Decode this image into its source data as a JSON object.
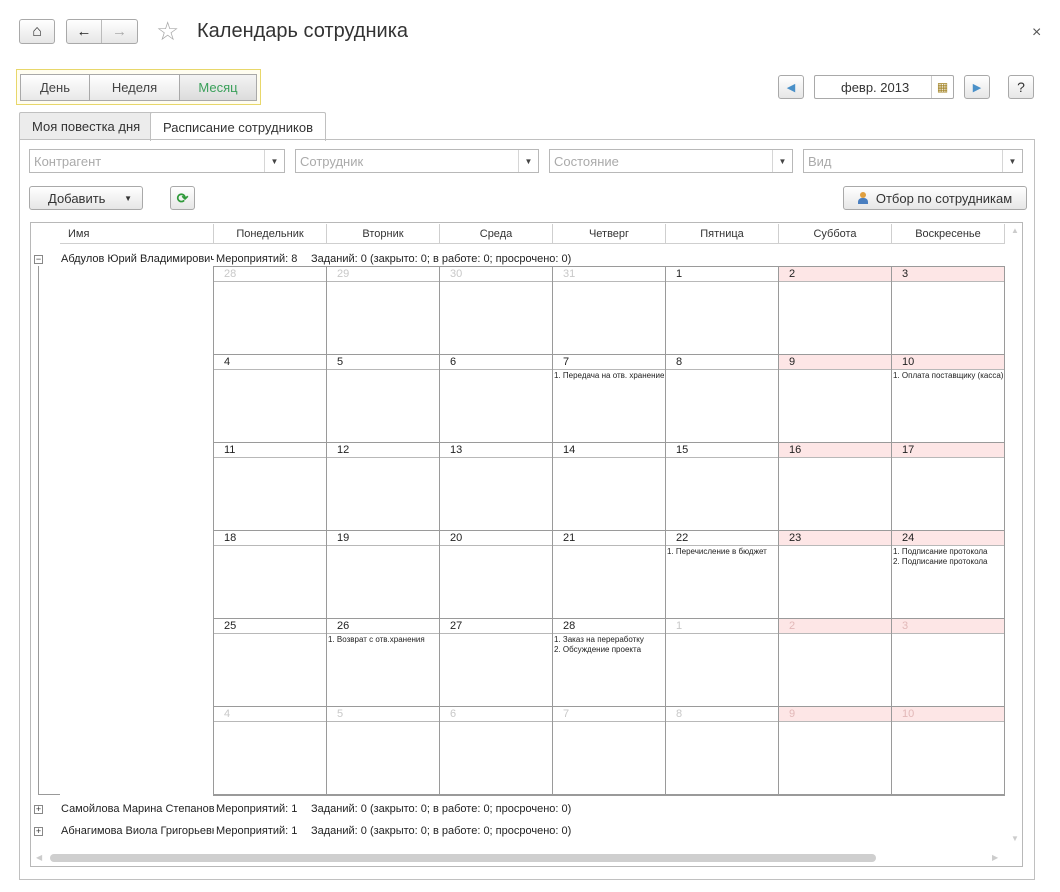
{
  "window": {
    "title": "Календарь сотрудника",
    "close_glyph": "×"
  },
  "nav": {
    "home_icon": "⌂",
    "back_icon": "←",
    "forward_icon": "→",
    "favorite_icon": "☆"
  },
  "period_buttons": [
    "День",
    "Неделя",
    "Месяц"
  ],
  "period_active": "Месяц",
  "period_nav": {
    "prev_icon": "◀",
    "current": "февр. 2013",
    "calendar_icon": "▦",
    "next_icon": "▶",
    "help": "?"
  },
  "tabs": [
    "Моя повестка дня",
    "Расписание сотрудников"
  ],
  "active_tab": "Расписание сотрудников",
  "filters": [
    {
      "placeholder": "Контрагент"
    },
    {
      "placeholder": "Сотрудник"
    },
    {
      "placeholder": "Состояние"
    },
    {
      "placeholder": "Вид"
    }
  ],
  "toolbar": {
    "add_label": "Добавить",
    "refresh_icon": "⟳",
    "select_employees_label": "Отбор по сотрудникам"
  },
  "grid": {
    "name_header": "Имя",
    "weekdays": [
      "Понедельник",
      "Вторник",
      "Среда",
      "Четверг",
      "Пятница",
      "Суббота",
      "Воскресенье"
    ]
  },
  "employees": [
    {
      "name": "Абдулов Юрий Владимирович",
      "expanded": true,
      "events": "Мероприятий: 8",
      "tasks": "Заданий: 0 (закрыто: 0; в работе: 0; просрочено: 0)"
    },
    {
      "name": "Самойлова Марина Степановна",
      "expanded": false,
      "events": "Мероприятий: 1",
      "tasks": "Заданий: 0 (закрыто: 0; в работе: 0; просрочено: 0)"
    },
    {
      "name": "Абнагимова Виола Григорьевна",
      "expanded": false,
      "events": "Мероприятий: 1",
      "tasks": "Заданий: 0 (закрыто: 0; в работе: 0; просрочено: 0)"
    }
  ],
  "calendar": {
    "weeks": [
      [
        {
          "d": "28",
          "other": true
        },
        {
          "d": "29",
          "other": true
        },
        {
          "d": "30",
          "other": true
        },
        {
          "d": "31",
          "other": true
        },
        {
          "d": "1"
        },
        {
          "d": "2"
        },
        {
          "d": "3"
        }
      ],
      [
        {
          "d": "4"
        },
        {
          "d": "5"
        },
        {
          "d": "6"
        },
        {
          "d": "7",
          "events": [
            "1. Передача на отв. хранение"
          ]
        },
        {
          "d": "8"
        },
        {
          "d": "9"
        },
        {
          "d": "10",
          "events": [
            "1. Оплата поставщику (касса)"
          ]
        }
      ],
      [
        {
          "d": "11"
        },
        {
          "d": "12"
        },
        {
          "d": "13"
        },
        {
          "d": "14"
        },
        {
          "d": "15"
        },
        {
          "d": "16"
        },
        {
          "d": "17"
        }
      ],
      [
        {
          "d": "18"
        },
        {
          "d": "19"
        },
        {
          "d": "20"
        },
        {
          "d": "21"
        },
        {
          "d": "22",
          "events": [
            "1. Перечисление в бюджет"
          ]
        },
        {
          "d": "23"
        },
        {
          "d": "24",
          "events": [
            "1. Подписание протокола",
            "2. Подписание протокола"
          ]
        }
      ],
      [
        {
          "d": "25"
        },
        {
          "d": "26",
          "events": [
            "1. Возврат с отв.хранения"
          ]
        },
        {
          "d": "27"
        },
        {
          "d": "28",
          "events": [
            "1. Заказ на переработку",
            "2. Обсуждение проекта"
          ]
        },
        {
          "d": "1",
          "other": true
        },
        {
          "d": "2",
          "other": true
        },
        {
          "d": "3",
          "other": true
        }
      ],
      [
        {
          "d": "4",
          "other": true
        },
        {
          "d": "5",
          "other": true
        },
        {
          "d": "6",
          "other": true
        },
        {
          "d": "7",
          "other": true
        },
        {
          "d": "8",
          "other": true
        },
        {
          "d": "9",
          "other": true
        },
        {
          "d": "10",
          "other": true
        }
      ]
    ]
  },
  "colors": {
    "weekend_header": "#fde6e6",
    "active_period": "#3aa05a",
    "nav_arrow": "#4a90c8",
    "refresh": "#2f9a3a"
  }
}
